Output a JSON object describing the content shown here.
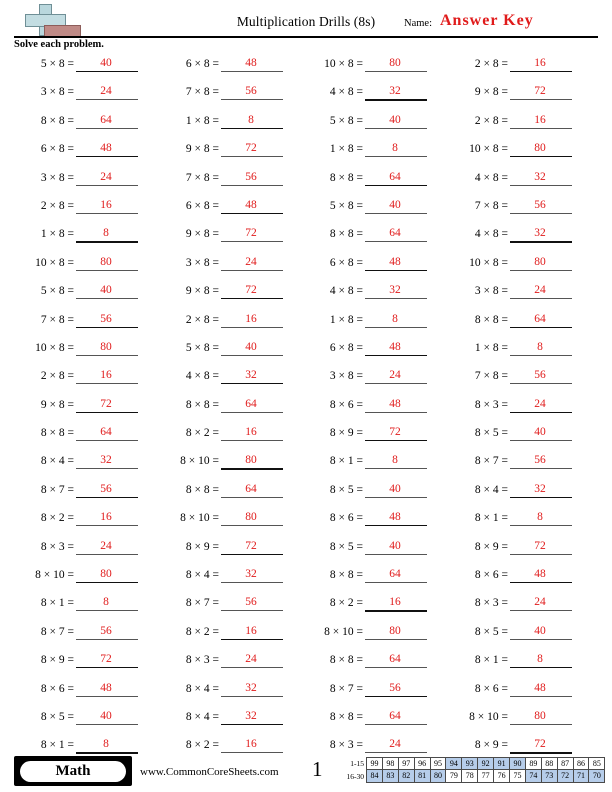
{
  "header": {
    "logo_name": "plus-block-logo",
    "title": "Multiplication Drills (8s)",
    "name_label": "Name:",
    "name_value": "Answer Key",
    "instructions": "Solve each problem.",
    "answer_color": "#e01b1b"
  },
  "columns": [
    {
      "problems": [
        {
          "expr": "5 × 8 =",
          "answer": "40"
        },
        {
          "expr": "3 × 8 =",
          "answer": "24"
        },
        {
          "expr": "8 × 8 =",
          "answer": "64"
        },
        {
          "expr": "6 × 8 =",
          "answer": "48"
        },
        {
          "expr": "3 × 8 =",
          "answer": "24"
        },
        {
          "expr": "2 × 8 =",
          "answer": "16"
        },
        {
          "expr": "1 × 8 =",
          "answer": "8"
        },
        {
          "expr": "10 × 8 =",
          "answer": "80"
        },
        {
          "expr": "5 × 8 =",
          "answer": "40"
        },
        {
          "expr": "7 × 8 =",
          "answer": "56"
        },
        {
          "expr": "10 × 8 =",
          "answer": "80"
        },
        {
          "expr": "2 × 8 =",
          "answer": "16"
        },
        {
          "expr": "9 × 8 =",
          "answer": "72"
        },
        {
          "expr": "8 × 8 =",
          "answer": "64"
        },
        {
          "expr": "8 × 4 =",
          "answer": "32"
        },
        {
          "expr": "8 × 7 =",
          "answer": "56"
        },
        {
          "expr": "8 × 2 =",
          "answer": "16"
        },
        {
          "expr": "8 × 3 =",
          "answer": "24"
        },
        {
          "expr": "8 × 10 =",
          "answer": "80"
        },
        {
          "expr": "8 × 1 =",
          "answer": "8"
        },
        {
          "expr": "8 × 7 =",
          "answer": "56"
        },
        {
          "expr": "8 × 9 =",
          "answer": "72"
        },
        {
          "expr": "8 × 6 =",
          "answer": "48"
        },
        {
          "expr": "8 × 5 =",
          "answer": "40"
        },
        {
          "expr": "8 × 1 =",
          "answer": "8"
        }
      ]
    },
    {
      "problems": [
        {
          "expr": "6 × 8 =",
          "answer": "48"
        },
        {
          "expr": "7 × 8 =",
          "answer": "56"
        },
        {
          "expr": "1 × 8 =",
          "answer": "8"
        },
        {
          "expr": "9 × 8 =",
          "answer": "72"
        },
        {
          "expr": "7 × 8 =",
          "answer": "56"
        },
        {
          "expr": "6 × 8 =",
          "answer": "48"
        },
        {
          "expr": "9 × 8 =",
          "answer": "72"
        },
        {
          "expr": "3 × 8 =",
          "answer": "24"
        },
        {
          "expr": "9 × 8 =",
          "answer": "72"
        },
        {
          "expr": "2 × 8 =",
          "answer": "16"
        },
        {
          "expr": "5 × 8 =",
          "answer": "40"
        },
        {
          "expr": "4 × 8 =",
          "answer": "32"
        },
        {
          "expr": "8 × 8 =",
          "answer": "64"
        },
        {
          "expr": "8 × 2 =",
          "answer": "16"
        },
        {
          "expr": "8 × 10 =",
          "answer": "80"
        },
        {
          "expr": "8 × 8 =",
          "answer": "64"
        },
        {
          "expr": "8 × 10 =",
          "answer": "80"
        },
        {
          "expr": "8 × 9 =",
          "answer": "72"
        },
        {
          "expr": "8 × 4 =",
          "answer": "32"
        },
        {
          "expr": "8 × 7 =",
          "answer": "56"
        },
        {
          "expr": "8 × 2 =",
          "answer": "16"
        },
        {
          "expr": "8 × 3 =",
          "answer": "24"
        },
        {
          "expr": "8 × 4 =",
          "answer": "32"
        },
        {
          "expr": "8 × 4 =",
          "answer": "32"
        },
        {
          "expr": "8 × 2 =",
          "answer": "16"
        }
      ]
    },
    {
      "problems": [
        {
          "expr": "10 × 8 =",
          "answer": "80"
        },
        {
          "expr": "4 × 8 =",
          "answer": "32"
        },
        {
          "expr": "5 × 8 =",
          "answer": "40"
        },
        {
          "expr": "1 × 8 =",
          "answer": "8"
        },
        {
          "expr": "8 × 8 =",
          "answer": "64"
        },
        {
          "expr": "5 × 8 =",
          "answer": "40"
        },
        {
          "expr": "8 × 8 =",
          "answer": "64"
        },
        {
          "expr": "6 × 8 =",
          "answer": "48"
        },
        {
          "expr": "4 × 8 =",
          "answer": "32"
        },
        {
          "expr": "1 × 8 =",
          "answer": "8"
        },
        {
          "expr": "6 × 8 =",
          "answer": "48"
        },
        {
          "expr": "3 × 8 =",
          "answer": "24"
        },
        {
          "expr": "8 × 6 =",
          "answer": "48"
        },
        {
          "expr": "8 × 9 =",
          "answer": "72"
        },
        {
          "expr": "8 × 1 =",
          "answer": "8"
        },
        {
          "expr": "8 × 5 =",
          "answer": "40"
        },
        {
          "expr": "8 × 6 =",
          "answer": "48"
        },
        {
          "expr": "8 × 5 =",
          "answer": "40"
        },
        {
          "expr": "8 × 8 =",
          "answer": "64"
        },
        {
          "expr": "8 × 2 =",
          "answer": "16"
        },
        {
          "expr": "8 × 10 =",
          "answer": "80"
        },
        {
          "expr": "8 × 8 =",
          "answer": "64"
        },
        {
          "expr": "8 × 7 =",
          "answer": "56"
        },
        {
          "expr": "8 × 8 =",
          "answer": "64"
        },
        {
          "expr": "8 × 3 =",
          "answer": "24"
        }
      ]
    },
    {
      "problems": [
        {
          "expr": "2 × 8 =",
          "answer": "16"
        },
        {
          "expr": "9 × 8 =",
          "answer": "72"
        },
        {
          "expr": "2 × 8 =",
          "answer": "16"
        },
        {
          "expr": "10 × 8 =",
          "answer": "80"
        },
        {
          "expr": "4 × 8 =",
          "answer": "32"
        },
        {
          "expr": "7 × 8 =",
          "answer": "56"
        },
        {
          "expr": "4 × 8 =",
          "answer": "32"
        },
        {
          "expr": "10 × 8 =",
          "answer": "80"
        },
        {
          "expr": "3 × 8 =",
          "answer": "24"
        },
        {
          "expr": "8 × 8 =",
          "answer": "64"
        },
        {
          "expr": "1 × 8 =",
          "answer": "8"
        },
        {
          "expr": "7 × 8 =",
          "answer": "56"
        },
        {
          "expr": "8 × 3 =",
          "answer": "24"
        },
        {
          "expr": "8 × 5 =",
          "answer": "40"
        },
        {
          "expr": "8 × 7 =",
          "answer": "56"
        },
        {
          "expr": "8 × 4 =",
          "answer": "32"
        },
        {
          "expr": "8 × 1 =",
          "answer": "8"
        },
        {
          "expr": "8 × 9 =",
          "answer": "72"
        },
        {
          "expr": "8 × 6 =",
          "answer": "48"
        },
        {
          "expr": "8 × 3 =",
          "answer": "24"
        },
        {
          "expr": "8 × 5 =",
          "answer": "40"
        },
        {
          "expr": "8 × 1 =",
          "answer": "8"
        },
        {
          "expr": "8 × 6 =",
          "answer": "48"
        },
        {
          "expr": "8 × 10 =",
          "answer": "80"
        },
        {
          "expr": "8 × 9 =",
          "answer": "72"
        }
      ]
    }
  ],
  "footer": {
    "subject_badge": "Math",
    "website": "www.CommonCoreSheets.com",
    "page_number": "1",
    "score_table": {
      "highlight_color": "#b6cdea",
      "rows": [
        {
          "label": "1-15",
          "cells": [
            {
              "value": "99",
              "highlighted": false
            },
            {
              "value": "98",
              "highlighted": false
            },
            {
              "value": "97",
              "highlighted": false
            },
            {
              "value": "96",
              "highlighted": false
            },
            {
              "value": "95",
              "highlighted": false
            },
            {
              "value": "94",
              "highlighted": true
            },
            {
              "value": "93",
              "highlighted": true
            },
            {
              "value": "92",
              "highlighted": true
            },
            {
              "value": "91",
              "highlighted": true
            },
            {
              "value": "90",
              "highlighted": true
            },
            {
              "value": "89",
              "highlighted": false
            },
            {
              "value": "88",
              "highlighted": false
            },
            {
              "value": "87",
              "highlighted": false
            },
            {
              "value": "86",
              "highlighted": false
            },
            {
              "value": "85",
              "highlighted": false
            }
          ]
        },
        {
          "label": "16-30",
          "cells": [
            {
              "value": "84",
              "highlighted": true
            },
            {
              "value": "83",
              "highlighted": true
            },
            {
              "value": "82",
              "highlighted": true
            },
            {
              "value": "81",
              "highlighted": true
            },
            {
              "value": "80",
              "highlighted": true
            },
            {
              "value": "79",
              "highlighted": false
            },
            {
              "value": "78",
              "highlighted": false
            },
            {
              "value": "77",
              "highlighted": false
            },
            {
              "value": "76",
              "highlighted": false
            },
            {
              "value": "75",
              "highlighted": false
            },
            {
              "value": "74",
              "highlighted": true
            },
            {
              "value": "73",
              "highlighted": true
            },
            {
              "value": "72",
              "highlighted": true
            },
            {
              "value": "71",
              "highlighted": true
            },
            {
              "value": "70",
              "highlighted": true
            }
          ]
        }
      ]
    }
  }
}
